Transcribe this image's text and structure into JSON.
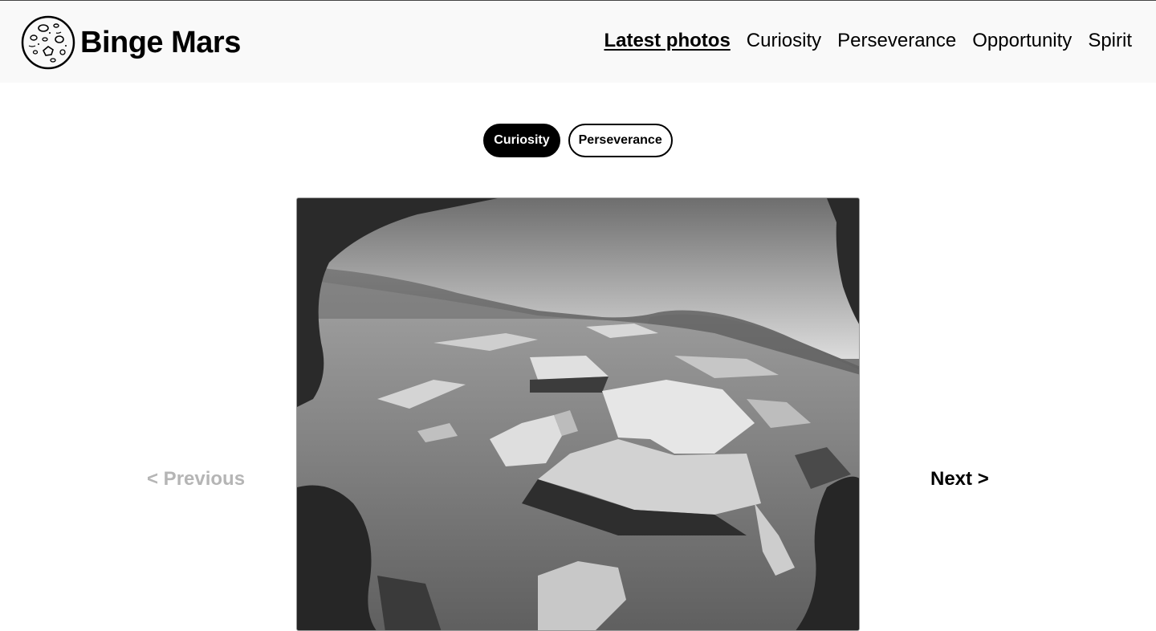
{
  "header": {
    "brand": "Binge Mars",
    "logo_icon": "mars-planet-icon",
    "nav": [
      {
        "label": "Latest photos",
        "active": true
      },
      {
        "label": "Curiosity",
        "active": false
      },
      {
        "label": "Perseverance",
        "active": false
      },
      {
        "label": "Opportunity",
        "active": false
      },
      {
        "label": "Spirit",
        "active": false
      }
    ]
  },
  "filters": [
    {
      "label": "Curiosity",
      "selected": true
    },
    {
      "label": "Perseverance",
      "selected": false
    }
  ],
  "pager": {
    "previous_label": "< Previous",
    "next_label": "Next >",
    "previous_disabled": true
  }
}
